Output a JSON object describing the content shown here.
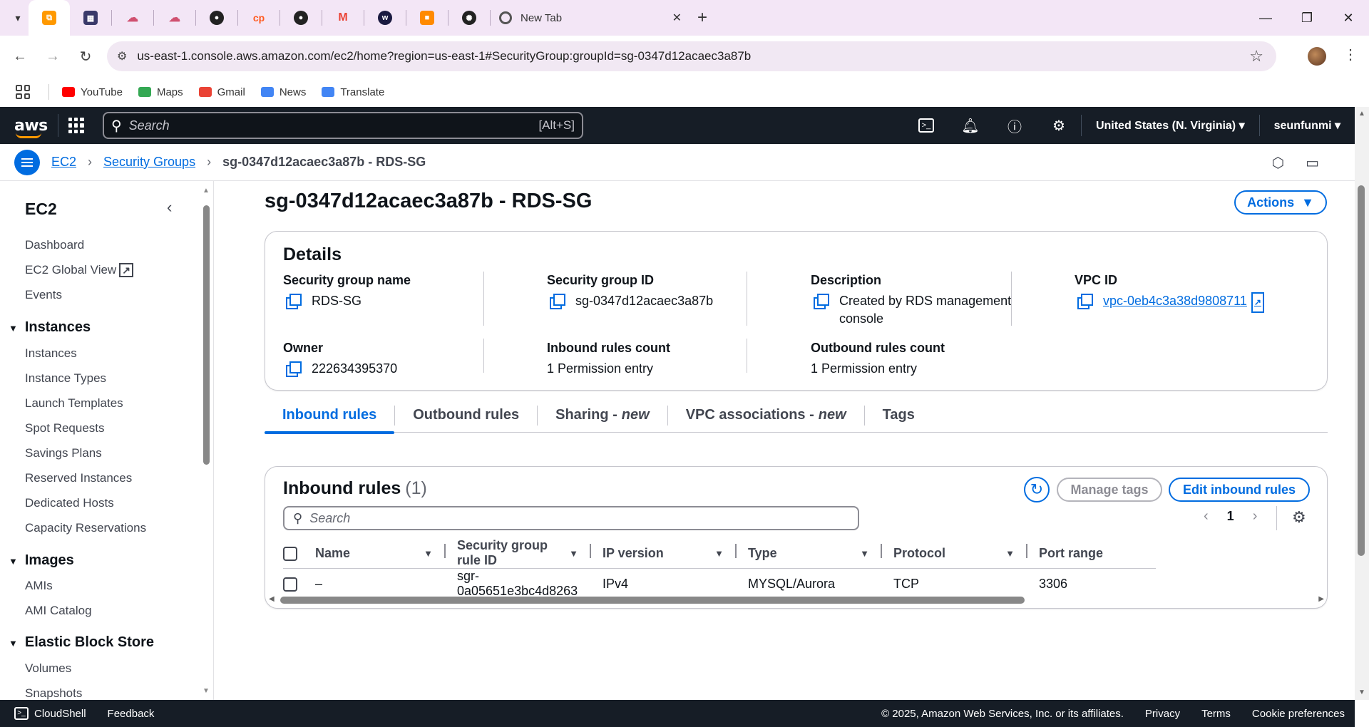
{
  "browser": {
    "tabs": [
      {
        "icon": "aws-console-favicon",
        "color": "#ff9900",
        "active": true
      },
      {
        "icon": "gallery-favicon",
        "color": "#3a3a6a"
      },
      {
        "icon": "cloud-favicon",
        "color": "#d05070"
      },
      {
        "icon": "cloud-favicon",
        "color": "#d05070"
      },
      {
        "icon": "github-favicon",
        "color": "#222222"
      },
      {
        "icon": "cp-favicon",
        "color": "#ff5a1f"
      },
      {
        "icon": "github-favicon",
        "color": "#222222"
      },
      {
        "icon": "gmail-favicon",
        "color": "#ea4335"
      },
      {
        "icon": "w-favicon",
        "color": "#1a1a40"
      },
      {
        "icon": "box-favicon",
        "color": "#ff8a00"
      },
      {
        "icon": "openai-favicon",
        "color": "#222222"
      }
    ],
    "new_tab_title": "New Tab",
    "url": "us-east-1.console.aws.amazon.com/ec2/home?region=us-east-1#SecurityGroup:groupId=sg-0347d12acaec3a87b",
    "bookmarks": [
      {
        "label": "YouTube",
        "color": "#ff0000"
      },
      {
        "label": "Maps",
        "color": "#34a853"
      },
      {
        "label": "Gmail",
        "color": "#ea4335"
      },
      {
        "label": "News",
        "color": "#4285f4"
      },
      {
        "label": "Translate",
        "color": "#4285f4"
      }
    ]
  },
  "aws_nav": {
    "logo": "aws",
    "search_placeholder": "Search",
    "search_shortcut": "[Alt+S]",
    "region": "United States (N. Virginia)",
    "user": "seunfunmi"
  },
  "breadcrumb": {
    "items": [
      "EC2",
      "Security Groups"
    ],
    "current": "sg-0347d12acaec3a87b - RDS-SG"
  },
  "sidebar": {
    "title": "EC2",
    "top_items": [
      "Dashboard",
      "EC2 Global View",
      "Events"
    ],
    "sections": [
      {
        "title": "Instances",
        "items": [
          "Instances",
          "Instance Types",
          "Launch Templates",
          "Spot Requests",
          "Savings Plans",
          "Reserved Instances",
          "Dedicated Hosts",
          "Capacity Reservations"
        ]
      },
      {
        "title": "Images",
        "items": [
          "AMIs",
          "AMI Catalog"
        ]
      },
      {
        "title": "Elastic Block Store",
        "items": [
          "Volumes",
          "Snapshots"
        ]
      }
    ]
  },
  "page": {
    "title": "sg-0347d12acaec3a87b - RDS-SG",
    "actions_label": "Actions"
  },
  "details": {
    "heading": "Details",
    "fields": {
      "sg_name": {
        "label": "Security group name",
        "value": "RDS-SG"
      },
      "sg_id": {
        "label": "Security group ID",
        "value": "sg-0347d12acaec3a87b"
      },
      "description": {
        "label": "Description",
        "value": "Created by RDS management console"
      },
      "vpc_id": {
        "label": "VPC ID",
        "value": "vpc-0eb4c3a38d9808711"
      },
      "owner": {
        "label": "Owner",
        "value": "222634395370"
      },
      "inbound_count": {
        "label": "Inbound rules count",
        "value": "1 Permission entry"
      },
      "outbound_count": {
        "label": "Outbound rules count",
        "value": "1 Permission entry"
      }
    }
  },
  "tabs": [
    {
      "label": "Inbound rules",
      "suffix": "",
      "active": true
    },
    {
      "label": "Outbound rules",
      "suffix": ""
    },
    {
      "label": "Sharing -",
      "suffix": "new"
    },
    {
      "label": "VPC associations -",
      "suffix": "new"
    },
    {
      "label": "Tags",
      "suffix": ""
    }
  ],
  "inbound_rules": {
    "heading": "Inbound rules",
    "count": "(1)",
    "manage_tags_label": "Manage tags",
    "edit_label": "Edit inbound rules",
    "search_placeholder": "Search",
    "page_number": "1",
    "columns": [
      "Name",
      "Security group rule ID",
      "IP version",
      "Type",
      "Protocol",
      "Port range"
    ],
    "rows": [
      {
        "name": "–",
        "rule_id": "sgr-0a05651e3bc4d8263",
        "ip_version": "IPv4",
        "type": "MYSQL/Aurora",
        "protocol": "TCP",
        "port_range": "3306"
      }
    ]
  },
  "footer": {
    "cloudshell": "CloudShell",
    "feedback": "Feedback",
    "copyright": "© 2025, Amazon Web Services, Inc. or its affiliates.",
    "links": [
      "Privacy",
      "Terms",
      "Cookie preferences"
    ]
  },
  "colors": {
    "aws_dark": "#161d26",
    "link_blue": "#006ce0",
    "aws_orange": "#ff9900"
  }
}
